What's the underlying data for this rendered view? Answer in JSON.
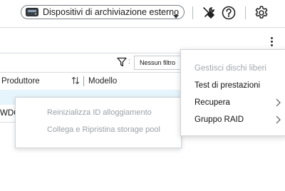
{
  "toolbar": {
    "storage_select": {
      "icon": "external-drive-icon",
      "selected": "Dispositivi di archiviazione esterno"
    },
    "icons": [
      "tools-icon",
      "help-icon",
      "gear-icon"
    ]
  },
  "more_icon": "more-vertical-icon",
  "filter": {
    "icon": "filter-icon",
    "separator": ":",
    "value": "Nessun filtro"
  },
  "table": {
    "columns": [
      "Produttore",
      "Modello"
    ],
    "sort_icon": "sort-icon",
    "rows": [
      {
        "produttore": "",
        "modello": "",
        "selected": true
      },
      {
        "produttore": "WDC",
        "modello": ""
      }
    ]
  },
  "context_menu": {
    "items": [
      {
        "label": "Reinizializza ID alloggiamento",
        "enabled": false
      },
      {
        "label": "Collega e Ripristina storage pool",
        "enabled": false
      }
    ]
  },
  "action_menu": {
    "items": [
      {
        "label": "Gestisci dischi liberi",
        "enabled": false
      },
      {
        "label": "Test di prestazioni",
        "enabled": true
      },
      {
        "label": "Recupera",
        "enabled": true,
        "submenu": true
      },
      {
        "label": "Gruppo RAID",
        "enabled": true,
        "submenu": true
      }
    ]
  },
  "colors": {
    "selected_row": "#e6f4fb",
    "disabled_text": "#9aa0a6",
    "border": "#d7dbe0"
  }
}
